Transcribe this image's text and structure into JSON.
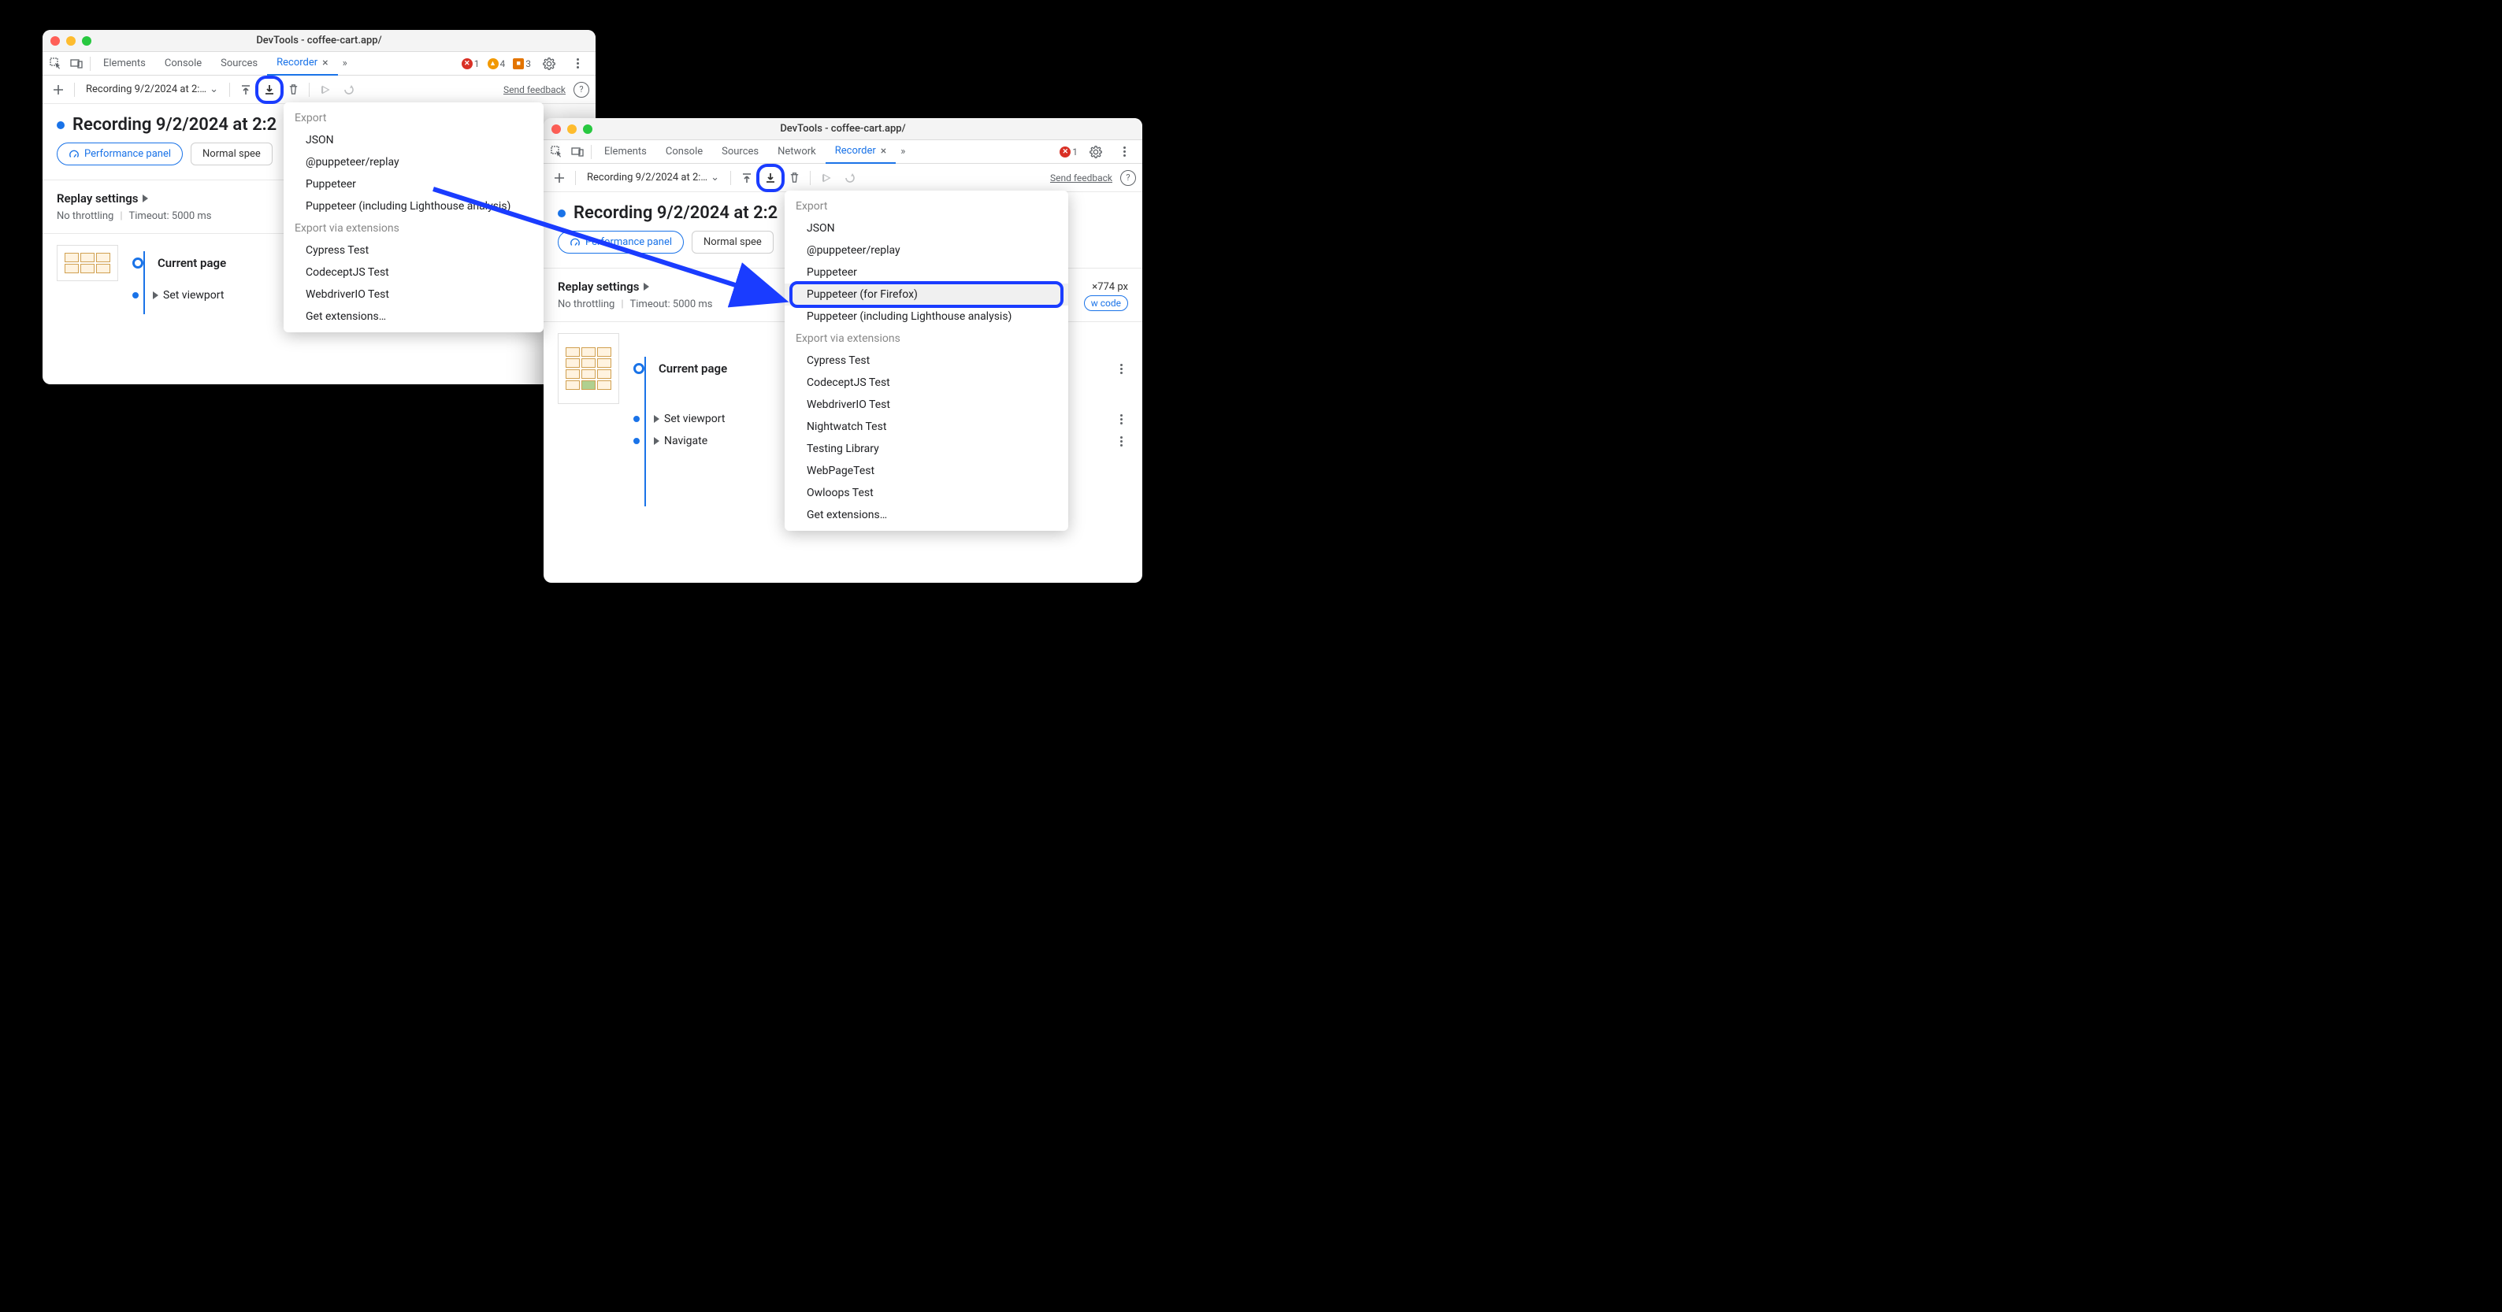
{
  "window_title": "DevTools - coffee-cart.app/",
  "tabs": {
    "elements": "Elements",
    "console": "Console",
    "sources": "Sources",
    "network": "Network",
    "recorder": "Recorder"
  },
  "counts": {
    "errors": "1",
    "warnings": "4",
    "issues": "3"
  },
  "toolbar": {
    "recording_name_trunc": "Recording 9/2/2024 at 2:…",
    "send_feedback": "Send feedback"
  },
  "recording_title_trunc": "Recording 9/2/2024 at 2:2",
  "perf_panel": "Performance panel",
  "normal_speed_trunc": "Normal spee",
  "replay": {
    "header": "Replay settings",
    "throttling": "No throttling",
    "timeout": "Timeout: 5000 ms"
  },
  "dimensions_label": "×774 px",
  "show_code_trunc": "w code",
  "steps": {
    "current_page": "Current page",
    "set_viewport": "Set viewport",
    "navigate": "Navigate"
  },
  "export_menu": {
    "header_export": "Export",
    "json": "JSON",
    "replay": "@puppeteer/replay",
    "puppeteer": "Puppeteer",
    "puppeteer_firefox": "Puppeteer (for Firefox)",
    "puppeteer_lighthouse": "Puppeteer (including Lighthouse analysis)",
    "header_ext": "Export via extensions",
    "cypress": "Cypress Test",
    "codecept": "CodeceptJS Test",
    "webdriverio": "WebdriverIO Test",
    "nightwatch": "Nightwatch Test",
    "testing_lib": "Testing Library",
    "webpagetest": "WebPageTest",
    "owloops": "Owloops Test",
    "get_ext": "Get extensions…"
  }
}
